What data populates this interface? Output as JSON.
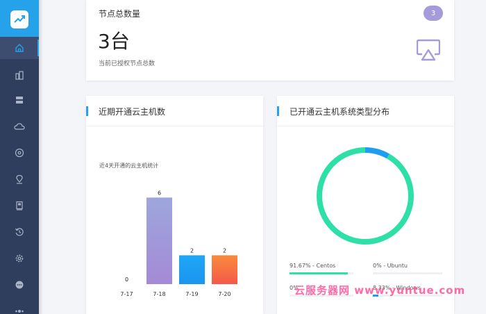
{
  "sidebar": {
    "logo_icon": "trend-chart-icon",
    "items": [
      {
        "name": "home",
        "icon": "home-icon",
        "active": true
      },
      {
        "name": "buildings",
        "icon": "buildings-icon"
      },
      {
        "name": "server",
        "icon": "server-icon"
      },
      {
        "name": "cloud",
        "icon": "cloud-icon"
      },
      {
        "name": "disk",
        "icon": "disc-icon"
      },
      {
        "name": "location",
        "icon": "map-pin-icon"
      },
      {
        "name": "machine",
        "icon": "machine-icon"
      },
      {
        "name": "restore",
        "icon": "restore-icon"
      },
      {
        "name": "settings",
        "icon": "gear-icon"
      },
      {
        "name": "more",
        "icon": "more-icon"
      },
      {
        "name": "users",
        "icon": "users-icon"
      }
    ]
  },
  "node_card": {
    "title": "节点总数量",
    "badge": "3",
    "count": "3台",
    "description": "当前已授权节点总数",
    "icon": "airplay-icon"
  },
  "bar_panel": {
    "title": "近期开通云主机数"
  },
  "pie_panel": {
    "title": "已开通云主机系统类型分布"
  },
  "colors": {
    "accent": "#25a2e9",
    "sidebar": "#2f3e5c",
    "donut_main": "#2fdfa8",
    "donut_secondary": "#1d9ef0"
  },
  "chart_data": [
    {
      "type": "bar",
      "subtitle": "近4天开通的云主机统计",
      "categories": [
        "7-17",
        "7-18",
        "7-19",
        "7-20"
      ],
      "values": [
        0,
        6,
        2,
        2
      ],
      "ylim": [
        0,
        6.5
      ],
      "grid": false
    },
    {
      "type": "pie",
      "series": [
        {
          "name": "Centos",
          "value": 91.67,
          "label": "91.67% - Centos",
          "color": "#2fdfa8"
        },
        {
          "name": "Ubuntu",
          "value": 0,
          "label": "0% - Ubuntu",
          "color": "#1d9ef0"
        },
        {
          "name": "",
          "value": 0,
          "label": "0%",
          "color": "#1d9ef0"
        },
        {
          "name": "Windows",
          "value": 8.33,
          "label": "8.33% - Windows",
          "color": "#1d9ef0"
        }
      ]
    }
  ],
  "watermark": "云服务器网 www.yuntue.com"
}
